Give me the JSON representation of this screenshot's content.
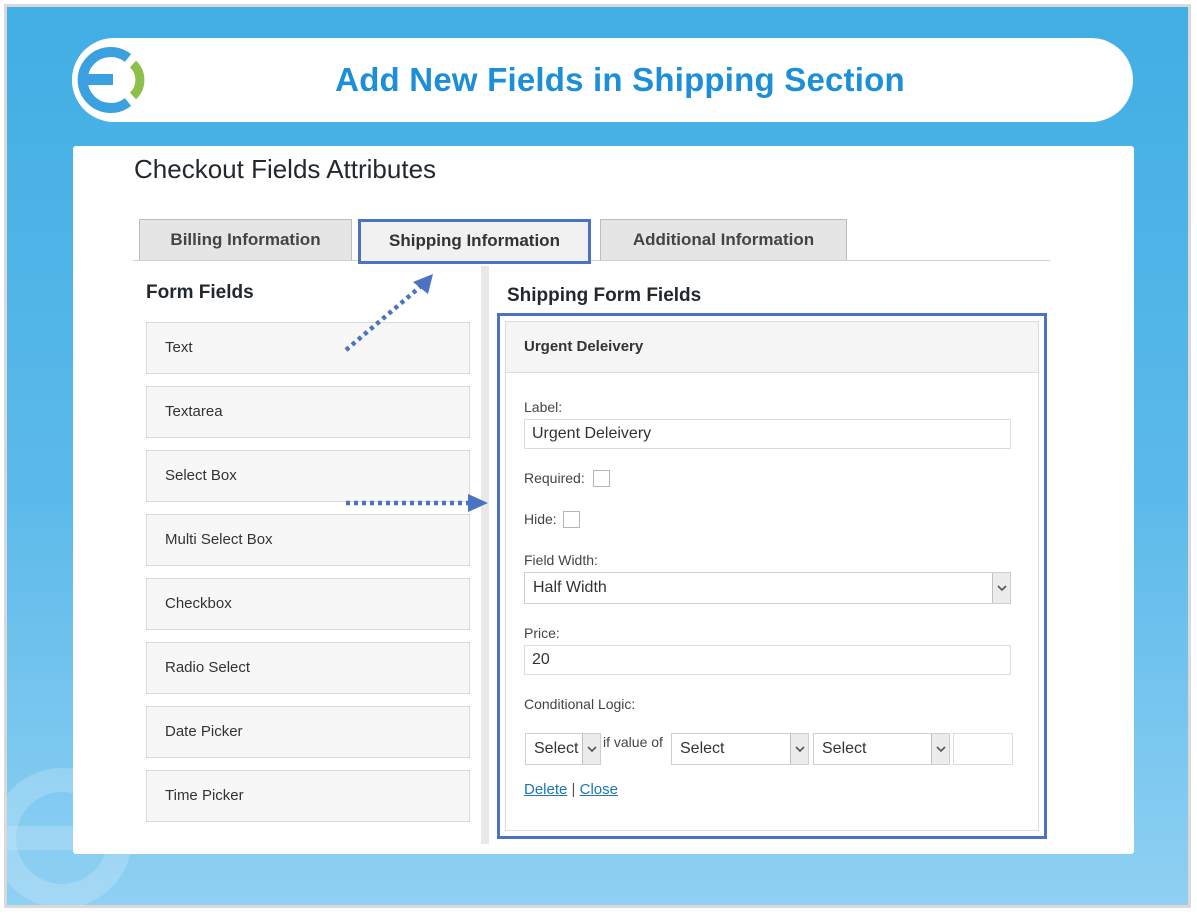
{
  "banner": {
    "title": "Add New Fields in Shipping Section"
  },
  "page": {
    "heading": "Checkout Fields Attributes"
  },
  "tabs": [
    {
      "label": "Billing Information"
    },
    {
      "label": "Shipping Information"
    },
    {
      "label": "Additional Information"
    }
  ],
  "form_fields": {
    "title": "Form Fields",
    "items": [
      "Text",
      "Textarea",
      "Select Box",
      "Multi Select Box",
      "Checkbox",
      "Radio Select",
      "Date Picker",
      "Time Picker"
    ]
  },
  "shipping_fields": {
    "title": "Shipping Form Fields",
    "field_name": "Urgent Deleivery",
    "label_caption": "Label:",
    "label_value": "Urgent Deleivery",
    "required_caption": "Required:",
    "required_checked": false,
    "hide_caption": "Hide:",
    "hide_checked": false,
    "width_caption": "Field Width:",
    "width_value": "Half Width",
    "price_caption": "Price:",
    "price_value": "20",
    "logic_caption": "Conditional Logic:",
    "logic_select_1": "Select",
    "logic_connector": "if value of",
    "logic_select_2": "Select",
    "logic_select_3": "Select",
    "logic_value": "",
    "delete_label": "Delete",
    "separator": "|",
    "close_label": "Close"
  },
  "colors": {
    "accent_blue": "#4a74c2",
    "banner_text": "#1c8fd8",
    "link": "#1a76b5",
    "logo_blue": "#3aa0e0",
    "logo_green": "#8cc04b"
  }
}
